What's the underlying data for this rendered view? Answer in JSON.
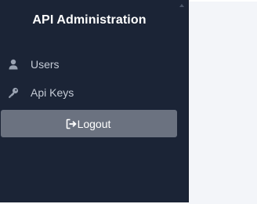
{
  "sidebar": {
    "title": "API Administration",
    "items": [
      {
        "label": "Users",
        "icon": "user-icon"
      },
      {
        "label": "Api Keys",
        "icon": "key-icon"
      }
    ],
    "logout": {
      "label": "Logout",
      "icon": "sign-out-icon"
    }
  },
  "colors": {
    "sidebar_bg": "#1b2436",
    "main_bg": "#f3f5f9",
    "logout_bg": "#6b7280",
    "nav_text": "#c5cbd6",
    "icon": "#9aa3b2"
  }
}
